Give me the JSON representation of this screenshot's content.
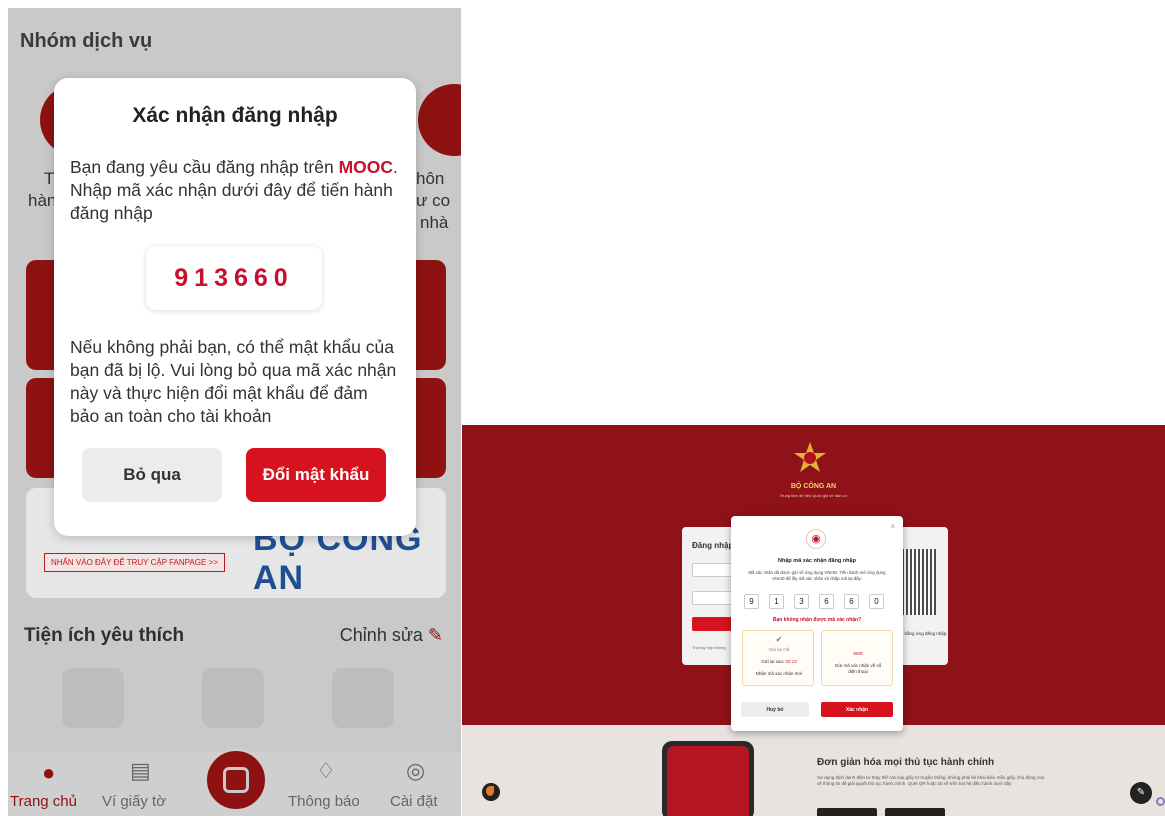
{
  "phone": {
    "section_title": "Nhóm dịch vụ",
    "side_left_1": "T",
    "side_left_2": "hàn",
    "side_right_1": "hôn",
    "side_right_2": "ư co",
    "side_right_3": "nhà",
    "bg_brand": "BỘ CÔNG AN",
    "bg_fanpage": "NHẤN VÀO ĐÂY ĐỂ TRUY CẬP FANPAGE  >>",
    "favorites_title": "Tiện ích yêu thích",
    "favorites_edit": "Chỉnh sửa",
    "nav": {
      "home": "Trang chủ",
      "wallet": "Ví giấy tờ",
      "notifications": "Thông báo",
      "settings": "Cài đặt"
    },
    "modal": {
      "title": "Xác nhận đăng nhập",
      "msg_prefix": "Bạn đang yêu cầu đăng nhập trên ",
      "msg_brand": "MOOC",
      "msg_suffix": ". Nhập mã xác nhận dưới đây để tiến hành đăng nhập",
      "code": "913660",
      "warning": "Nếu không phải bạn, có thể mật khẩu của bạn đã bị lộ. Vui lòng bỏ qua mã xác nhận này và thực hiện đổi mật khẩu để đảm bảo an toàn cho tài khoản",
      "skip_label": "Bỏ qua",
      "change_password_label": "Đổi mật khẩu"
    }
  },
  "web": {
    "org_name": "BỘ CÔNG AN",
    "org_sub": "Trung tâm dữ liệu Quốc gia về dân cư",
    "login_title": "Đăng nhập",
    "login_footer": "Trường hợp không",
    "qr_text": "R bằng ứng đăng nhập.",
    "dialog": {
      "close": "×",
      "title": "Nhập mã xác nhận đăng nhập",
      "desc": "Mã xác nhận đã được gửi về ứng dụng VNeID. Tiến hành mở ứng dụng VNeID để lấy mã xác nhận và nhập mã tại đây:",
      "digits": [
        "9",
        "1",
        "3",
        "6",
        "6",
        "0"
      ],
      "not_received": "Bạn không nhận được mã xác nhận?",
      "resend": {
        "label": "Gửi lại mã",
        "countdown_prefix": "Gửi lại sau: ",
        "countdown": "02:13",
        "note": "Nhận mã xác nhận mới"
      },
      "sms": {
        "label": "SMS",
        "note": "Gửi mã xác nhận về số điện thoại"
      },
      "cancel_label": "Huỷ bỏ",
      "confirm_label": "Xác nhận"
    },
    "promo": {
      "title": "Đơn giản hóa mọi thủ tục hành chính",
      "desc": "Sử dụng định danh điện tử thay thế các loại giấy tờ truyền thống, không phải kê khai biểu mẫu giấy, chủ động của về thông tin để giải quyết thủ tục hành chính. Quét QR hoặc tải về trên hai hệ điều hành dưới đây"
    }
  },
  "colors": {
    "brand_red": "#d6121e",
    "dark_red_bg": "#8f1219",
    "accent_gold": "#f3d36b"
  }
}
